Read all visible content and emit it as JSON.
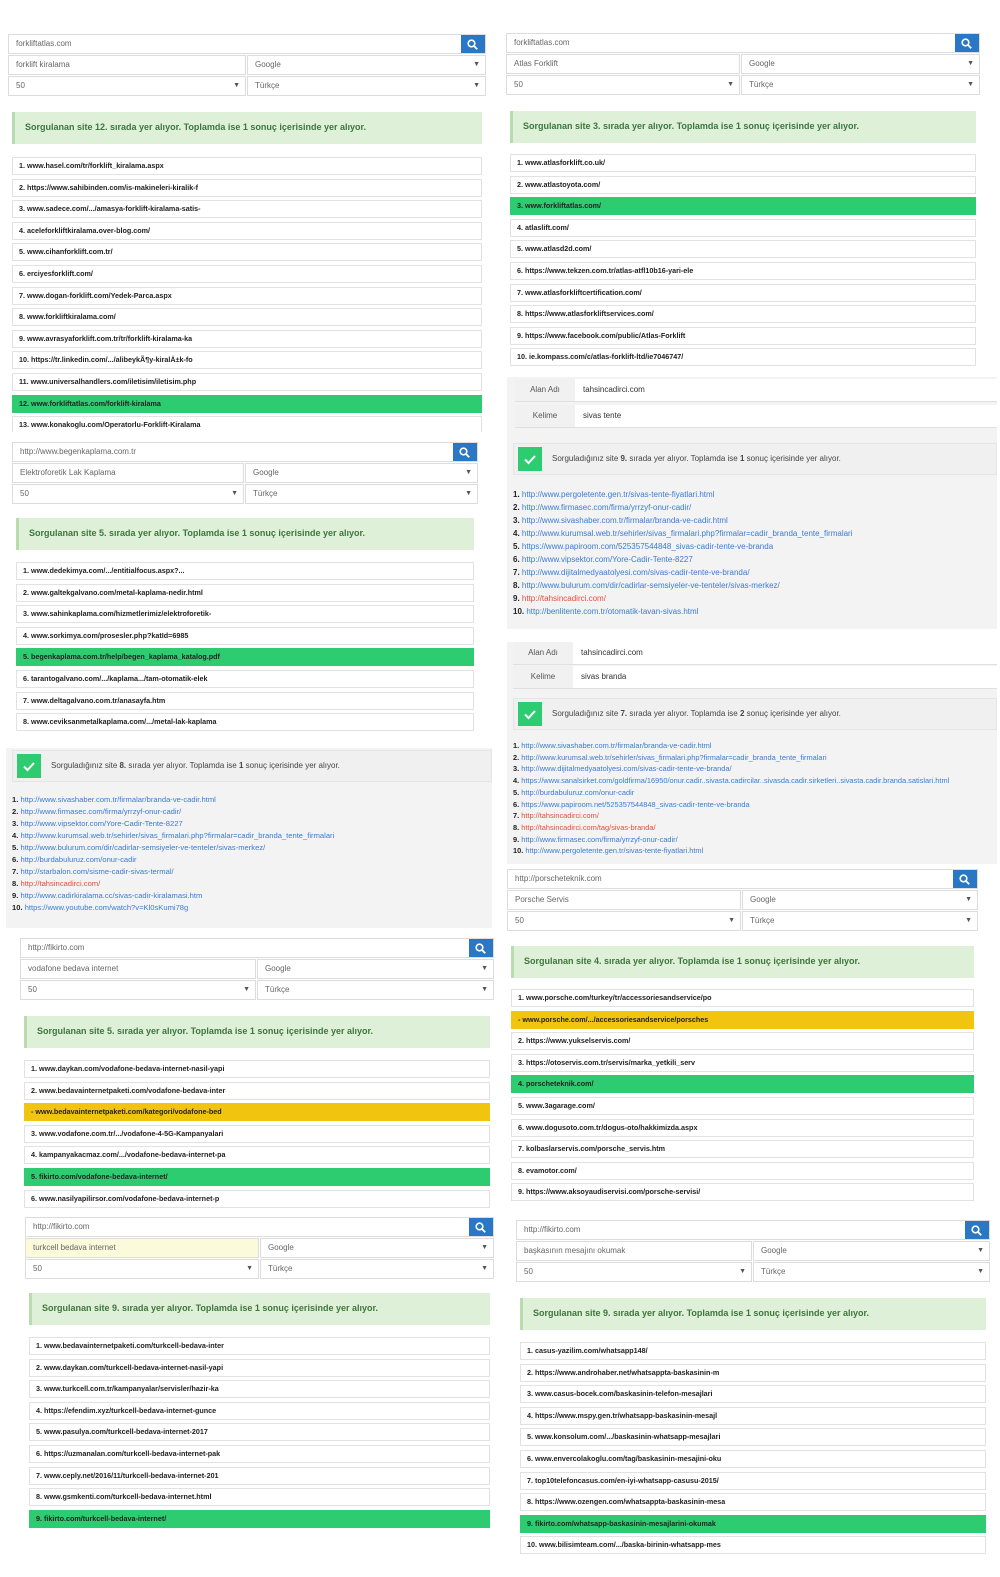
{
  "search_panels": [
    {
      "url": "forkliftatlas.com",
      "keyword": "forklift kiralama",
      "engine": "Google",
      "count": "50",
      "lang": "Türkçe",
      "result": "Sorgulanan site 12. sırada yer alıyor. Toplamda ise 1 sonuç içerisinde yer alıyor.",
      "rows": [
        {
          "t": "1. www.hasel.com/tr/forklift_kiralama.aspx",
          "c": ""
        },
        {
          "t": "2. https://www.sahibinden.com/is-makineleri-kiralik-f",
          "c": ""
        },
        {
          "t": "3. www.sadece.com/.../amasya-forklift-kiralama-satis-",
          "c": ""
        },
        {
          "t": "4. aceleforkliftkiralama.over-blog.com/",
          "c": ""
        },
        {
          "t": "5. www.cihanforklift.com.tr/",
          "c": ""
        },
        {
          "t": "6. erciyesforklift.com/",
          "c": ""
        },
        {
          "t": "7. www.dogan-forklift.com/Yedek-Parca.aspx",
          "c": ""
        },
        {
          "t": "8. www.forkliftkiralama.com/",
          "c": ""
        },
        {
          "t": "9. www.avrasyaforklift.com.tr/tr/forklift-kiralama-ka",
          "c": ""
        },
        {
          "t": "10. https://tr.linkedin.com/.../alibeykÃ¶y-kiralÄ±k-fo",
          "c": ""
        },
        {
          "t": "11. www.universalhandlers.com/iletisim/iletisim.php",
          "c": ""
        },
        {
          "t": "12. www.forkliftatlas.com/forklift-kiralama",
          "c": "green"
        },
        {
          "t": "13. www.konakoglu.com/Operatorlu-Forklift-Kiralama",
          "c": ""
        }
      ]
    },
    {
      "url": "forkliftatlas.com",
      "keyword": "Atlas Forklift",
      "engine": "Google",
      "count": "50",
      "lang": "Türkçe",
      "result": "Sorgulanan site 3. sırada yer alıyor. Toplamda ise 1 sonuç içerisinde yer alıyor.",
      "rows": [
        {
          "t": "1. www.atlasforklift.co.uk/",
          "c": ""
        },
        {
          "t": "2. www.atlastoyota.com/",
          "c": ""
        },
        {
          "t": "3. www.forkliftatlas.com/",
          "c": "green"
        },
        {
          "t": "4. atlaslift.com/",
          "c": ""
        },
        {
          "t": "5. www.atlasd2d.com/",
          "c": ""
        },
        {
          "t": "6. https://www.tekzen.com.tr/atlas-atfl10b16-yari-ele",
          "c": ""
        },
        {
          "t": "7. www.atlasforkliftcertification.com/",
          "c": ""
        },
        {
          "t": "8. https://www.atlasforkliftservices.com/",
          "c": ""
        },
        {
          "t": "9. https://www.facebook.com/public/Atlas-Forklift",
          "c": ""
        },
        {
          "t": "10. ie.kompass.com/c/atlas-forklift-ltd/ie7046747/",
          "c": ""
        }
      ]
    },
    {
      "url": "http://www.begenkaplama.com.tr",
      "keyword": "Elektroforetik Lak Kaplama",
      "engine": "Google",
      "count": "50",
      "lang": "Türkçe",
      "result": "Sorgulanan site 5. sırada yer alıyor. Toplamda ise 1 sonuç içerisinde yer alıyor.",
      "rows": [
        {
          "t": "1. www.dedekimya.com/.../entitialfocus.aspx?...",
          "c": ""
        },
        {
          "t": "2. www.galtekgalvano.com/metal-kaplama-nedir.html",
          "c": ""
        },
        {
          "t": "3. www.sahinkaplama.com/hizmetlerimiz/elektroforetik-",
          "c": ""
        },
        {
          "t": "4. www.sorkimya.com/prosesler.php?katId=6985",
          "c": ""
        },
        {
          "t": "5. begenkaplama.com.tr/help/begen_kaplama_katalog.pdf",
          "c": "green"
        },
        {
          "t": "6. tarantogalvano.com/.../kaplama.../tam-otomatik-elek",
          "c": ""
        },
        {
          "t": "7. www.deltagalvano.com.tr/anasayfa.htm",
          "c": ""
        },
        {
          "t": "8. www.ceviksanmetalkaplama.com/.../metal-lak-kaplama",
          "c": ""
        }
      ]
    },
    {
      "url": "http://porscheteknik.com",
      "keyword": "Porsche Servis",
      "engine": "Google",
      "count": "50",
      "lang": "Türkçe",
      "result": "Sorgulanan site 4. sırada yer alıyor. Toplamda ise 1 sonuç içerisinde yer alıyor.",
      "rows": [
        {
          "t": "1. www.porsche.com/turkey/tr/accessoriesandservice/po",
          "c": ""
        },
        {
          "t": "- www.porsche.com/.../accessoriesandservice/porsches",
          "c": "yellow"
        },
        {
          "t": "2. https://www.yukselservis.com/",
          "c": ""
        },
        {
          "t": "3. https://otoservis.com.tr/servis/marka_yetkili_serv",
          "c": ""
        },
        {
          "t": "4. porscheteknik.com/",
          "c": "green"
        },
        {
          "t": "5. www.3agarage.com/",
          "c": ""
        },
        {
          "t": "6. www.dogusoto.com.tr/dogus-oto/hakkimizda.aspx",
          "c": ""
        },
        {
          "t": "7. kolbaslarservis.com/porsche_servis.htm",
          "c": ""
        },
        {
          "t": "8. evamotor.com/",
          "c": ""
        },
        {
          "t": "9. https://www.aksoyaudiservisi.com/porsche-servisi/",
          "c": ""
        }
      ]
    },
    {
      "url": "http://fikirto.com",
      "keyword": "vodafone bedava internet",
      "engine": "Google",
      "count": "50",
      "lang": "Türkçe",
      "result": "Sorgulanan site 5. sırada yer alıyor. Toplamda ise 1 sonuç içerisinde yer alıyor.",
      "rows": [
        {
          "t": "1. www.daykan.com/vodafone-bedava-internet-nasil-yapi",
          "c": ""
        },
        {
          "t": "2. www.bedavainternetpaketi.com/vodafone-bedava-inter",
          "c": ""
        },
        {
          "t": "- www.bedavainternetpaketi.com/kategori/vodafone-bed",
          "c": "yellow"
        },
        {
          "t": "3. www.vodafone.com.tr/.../vodafone-4-5G-Kampanyalari",
          "c": ""
        },
        {
          "t": "4. kampanyakacmaz.com/.../vodafone-bedava-internet-pa",
          "c": ""
        },
        {
          "t": "5. fikirto.com/vodafone-bedava-internet/",
          "c": "green"
        },
        {
          "t": "6. www.nasilyapilirsor.com/vodafone-bedava-internet-p",
          "c": ""
        }
      ]
    },
    {
      "url": "http://fikirto.com",
      "keyword": "turkcell bedava internet",
      "engine": "Google",
      "count": "50",
      "lang": "Türkçe",
      "result": "Sorgulanan site 9. sırada yer alıyor. Toplamda ise 1 sonuç içerisinde yer alıyor.",
      "rows": [
        {
          "t": "1. www.bedavainternetpaketi.com/turkcell-bedava-inter",
          "c": ""
        },
        {
          "t": "2. www.daykan.com/turkcell-bedava-internet-nasil-yapi",
          "c": ""
        },
        {
          "t": "3. www.turkcell.com.tr/kampanyalar/servisler/hazir-ka",
          "c": ""
        },
        {
          "t": "4. https://efendim.xyz/turkcell-bedava-internet-gunce",
          "c": ""
        },
        {
          "t": "5. www.pasulya.com/turkcell-bedava-internet-2017",
          "c": ""
        },
        {
          "t": "6. https://uzmanalan.com/turkcell-bedava-internet-pak",
          "c": ""
        },
        {
          "t": "7. www.ceply.net/2016/11/turkcell-bedava-internet-201",
          "c": ""
        },
        {
          "t": "8. www.gsmkenti.com/turkcell-bedava-internet.html",
          "c": ""
        },
        {
          "t": "9. fikirto.com/turkcell-bedava-internet/",
          "c": "green"
        }
      ]
    },
    {
      "url": "http://fikirto.com",
      "keyword": "başkasının mesajını okumak",
      "engine": "Google",
      "count": "50",
      "lang": "Türkçe",
      "result": "Sorgulanan site 9. sırada yer alıyor. Toplamda ise 1 sonuç içerisinde yer alıyor.",
      "rows": [
        {
          "t": "1. casus-yazilim.com/whatsapp148/",
          "c": ""
        },
        {
          "t": "2. https://www.androhaber.net/whatsappta-baskasinin-m",
          "c": ""
        },
        {
          "t": "3. www.casus-bocek.com/baskasinin-telefon-mesajlari",
          "c": ""
        },
        {
          "t": "4. https://www.mspy.gen.tr/whatsapp-baskasinin-mesajl",
          "c": ""
        },
        {
          "t": "5. www.konsolum.com/.../baskasinin-whatsapp-mesajlari",
          "c": ""
        },
        {
          "t": "6. www.envercolakoglu.com/tag/baskasinin-mesajini-oku",
          "c": ""
        },
        {
          "t": "7. top10telefoncasus.com/en-iyi-whatsapp-casusu-2015/",
          "c": ""
        },
        {
          "t": "8. https://www.ozengen.com/whatsappta-baskasinin-mesa",
          "c": ""
        },
        {
          "t": "9. fikirto.com/whatsapp-baskasinin-mesajlarini-okumak",
          "c": "green"
        },
        {
          "t": "10. www.bilisimteam.com/.../baska-birinin-whatsapp-mes",
          "c": ""
        }
      ]
    }
  ],
  "grey_panels": [
    {
      "alan_label": "Alan Adı",
      "alan": "tahsincadirci.com",
      "kelime_label": "Kelime",
      "kelime": "sivas tente",
      "msg_pre": "Sorguladığınız site ",
      "pos": "9.",
      "msg_mid": " sırada yer alıyor. Toplamda ise ",
      "total": "1",
      "msg_post": " sonuç içerisinde yer alıyor.",
      "links": [
        {
          "n": "1.",
          "t": "http://www.pergoletente.gen.tr/sivas-tente-fiyatlari.html",
          "c": ""
        },
        {
          "n": "2.",
          "t": "http://www.firmasec.com/firma/yrrzyf-onur-cadir/",
          "c": ""
        },
        {
          "n": "3.",
          "t": "http://www.sivashaber.com.tr/firmalar/branda-ve-cadir.html",
          "c": ""
        },
        {
          "n": "4.",
          "t": "http://www.kurumsal.web.tr/sehirler/sivas_firmalari.php?firmalar=cadir_branda_tente_firmalari",
          "c": ""
        },
        {
          "n": "5.",
          "t": "https://www.papiroom.com/525357544848_sivas-cadir-tente-ve-branda",
          "c": ""
        },
        {
          "n": "6.",
          "t": "http://www.vipsektor.com/Yore-Cadir-Tente-8227",
          "c": ""
        },
        {
          "n": "7.",
          "t": "http://www.dijitalmedyaatolyesi.com/sivas-cadir-tente-ve-branda/",
          "c": ""
        },
        {
          "n": "8.",
          "t": "http://www.bulurum.com/dir/cadirlar-semsiyeler-ve-tenteler/sivas-merkez/",
          "c": ""
        },
        {
          "n": "9.",
          "t": "http://tahsincadirci.com/",
          "c": "red"
        },
        {
          "n": "10.",
          "t": "http://benlitente.com.tr/otomatik-tavan-sivas.html",
          "c": ""
        }
      ]
    },
    {
      "alan_label": "Alan Adı",
      "alan": "tahsincadirci.com",
      "kelime_label": "Kelime",
      "kelime": "sivas branda",
      "msg_pre": "Sorguladığınız site ",
      "pos": "7.",
      "msg_mid": " sırada yer alıyor. Toplamda ise ",
      "total": "2",
      "msg_post": " sonuç içerisinde yer alıyor.",
      "links": [
        {
          "n": "1.",
          "t": "http://www.sivashaber.com.tr/firmalar/branda-ve-cadir.html",
          "c": ""
        },
        {
          "n": "2.",
          "t": "http://www.kurumsal.web.tr/sehirler/sivas_firmalari.php?firmalar=cadir_branda_tente_firmalari",
          "c": ""
        },
        {
          "n": "3.",
          "t": "http://www.dijitalmedyaatolyesi.com/sivas-cadir-tente-ve-branda/",
          "c": ""
        },
        {
          "n": "4.",
          "t": "https://www.sanalsirket.com/goldfirma/16950/onur.cadir..sivasta.cadircilar..sivasda.cadir.sirketleri..sivasta.cadir.branda.satislari.html",
          "c": ""
        },
        {
          "n": "5.",
          "t": "http://burdabuluruz.com/onur-cadir",
          "c": ""
        },
        {
          "n": "6.",
          "t": "https://www.papiroom.net/525357544848_sivas-cadir-tente-ve-branda",
          "c": ""
        },
        {
          "n": "7.",
          "t": "http://tahsincadirci.com/",
          "c": "red"
        },
        {
          "n": "8.",
          "t": "http://tahsincadirci.com/tag/sivas-branda/",
          "c": "red"
        },
        {
          "n": "9.",
          "t": "http://www.firmasec.com/firma/yrrzyf-onur-cadir/",
          "c": ""
        },
        {
          "n": "10.",
          "t": "http://www.pergoletente.gen.tr/sivas-tente-fiyatlari.html",
          "c": ""
        }
      ]
    },
    {
      "alan_label": "",
      "alan": "",
      "kelime_label": "",
      "kelime": "",
      "msg_pre": "Sorguladığınız site ",
      "pos": "8.",
      "msg_mid": " sırada yer alıyor. Toplamda ise ",
      "total": "1",
      "msg_post": " sonuç içerisinde yer alıyor.",
      "links": [
        {
          "n": "1.",
          "t": "http://www.sivashaber.com.tr/firmalar/branda-ve-cadir.html",
          "c": ""
        },
        {
          "n": "2.",
          "t": "http://www.firmasec.com/firma/yrrzyf-onur-cadir/",
          "c": ""
        },
        {
          "n": "3.",
          "t": "http://www.vipsektor.com/Yore-Cadir-Tente-8227",
          "c": ""
        },
        {
          "n": "4.",
          "t": "http://www.kurumsal.web.tr/sehirler/sivas_firmalari.php?firmalar=cadir_branda_tente_firmalari",
          "c": ""
        },
        {
          "n": "5.",
          "t": "http://www.bulurum.com/dir/cadirlar-semsiyeler-ve-tenteler/sivas-merkez/",
          "c": ""
        },
        {
          "n": "6.",
          "t": "http://burdabuluruz.com/onur-cadir",
          "c": ""
        },
        {
          "n": "7.",
          "t": "http://starbalon.com/sisme-cadir-sivas-termal/",
          "c": ""
        },
        {
          "n": "8.",
          "t": "http://tahsincadirci.com/",
          "c": "red"
        },
        {
          "n": "9.",
          "t": "http://www.cadirkiralama.cc/sivas-cadir-kiralamasi.htm",
          "c": ""
        },
        {
          "n": "10.",
          "t": "https://www.youtube.com/watch?v=Kl0sKumi78g",
          "c": ""
        }
      ]
    }
  ]
}
